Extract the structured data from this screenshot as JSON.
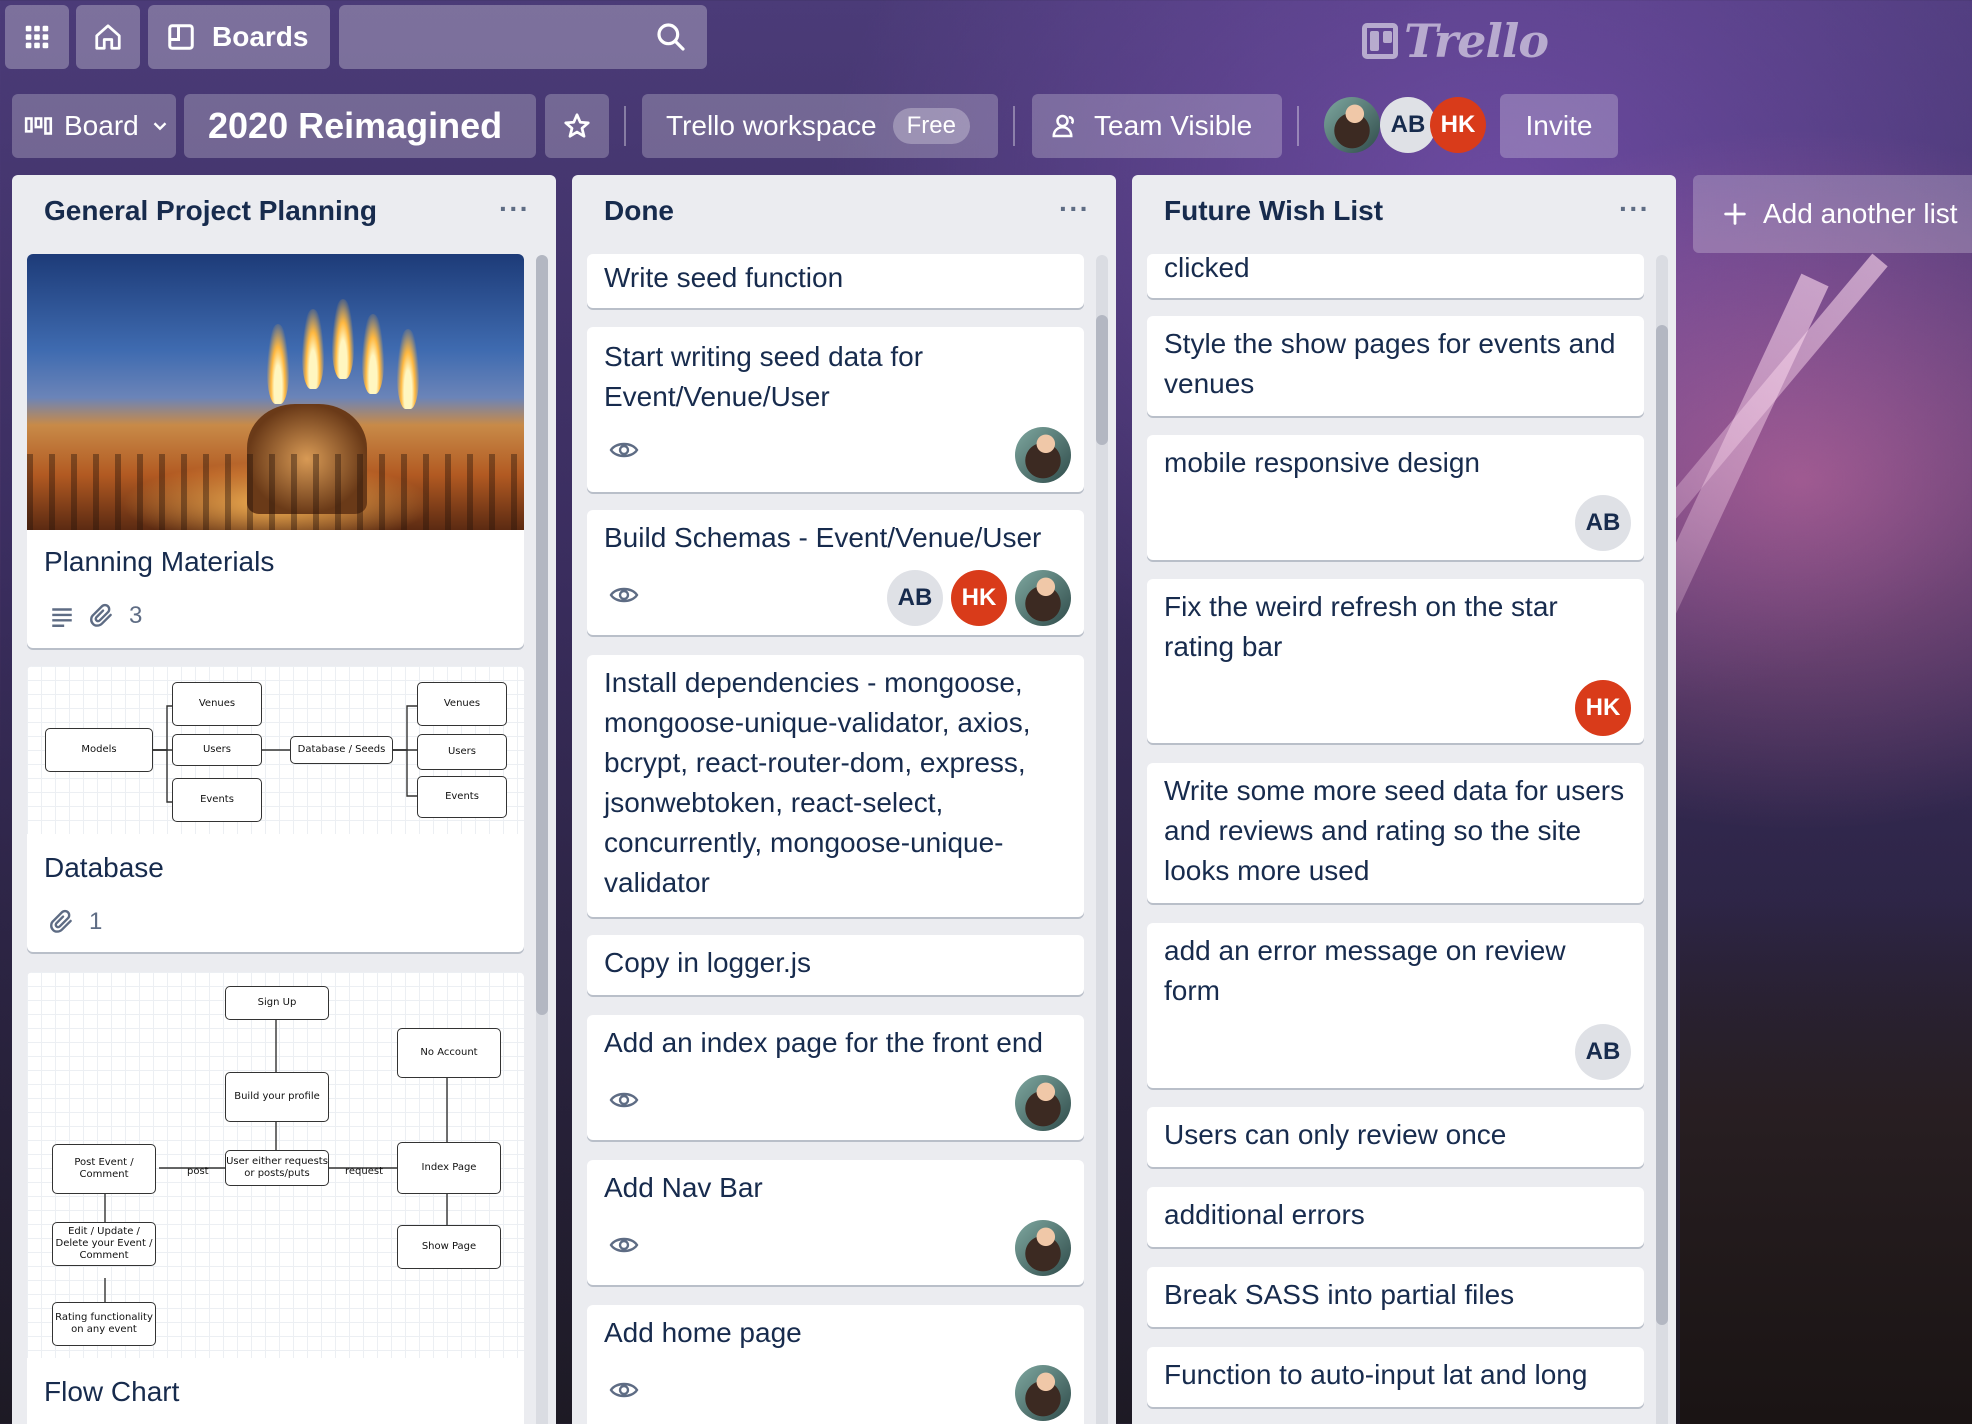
{
  "header": {
    "boards_label": "Boards",
    "search_placeholder": "",
    "logo_text": "Trello"
  },
  "board": {
    "view_label": "Board",
    "title": "2020 Reimagined",
    "workspace_label": "Trello workspace",
    "workspace_badge": "Free",
    "visibility_label": "Team Visible",
    "members": [
      "AB",
      "HK"
    ],
    "invite_label": "Invite"
  },
  "lists": [
    {
      "title": "General Project Planning",
      "cards": [
        {
          "title": "Planning Materials",
          "attachments": "3"
        },
        {
          "title": "Database",
          "attachments": "1"
        },
        {
          "title": "Flow Chart"
        }
      ]
    },
    {
      "title": "Done",
      "cards": [
        {
          "title": "Write seed function"
        },
        {
          "title": "Start writing seed data for Event/Venue/User"
        },
        {
          "title": "Build Schemas - Event/Venue/User",
          "members": [
            "AB",
            "HK"
          ]
        },
        {
          "title": "Install dependencies - mongoose, mongoose-unique-validator, axios, bcrypt, react-router-dom, express, jsonwebtoken, react-select, concurrently, mongoose-unique-validator"
        },
        {
          "title": "Copy in logger.js"
        },
        {
          "title": "Add an index page for the front end"
        },
        {
          "title": "Add Nav Bar"
        },
        {
          "title": "Add home page"
        }
      ]
    },
    {
      "title": "Future Wish List",
      "cards": [
        {
          "title": "clicked"
        },
        {
          "title": "Style the show pages for events and venues"
        },
        {
          "title": "mobile responsive design",
          "members": [
            "AB"
          ]
        },
        {
          "title": "Fix the weird refresh on the star rating bar",
          "members": [
            "HK"
          ]
        },
        {
          "title": "Write some more seed data for users and reviews and rating so the site looks more used"
        },
        {
          "title": "add an error message on review form",
          "members": [
            "AB"
          ]
        },
        {
          "title": "Users can only review once"
        },
        {
          "title": "additional errors"
        },
        {
          "title": "Break SASS into partial files"
        },
        {
          "title": "Function to auto-input lat and long"
        }
      ]
    }
  ],
  "add_list_label": "Add another list",
  "diagram_db": {
    "models": "Models",
    "venues": "Venues",
    "users": "Users",
    "events": "Events",
    "seeds": "Database / Seeds"
  },
  "diagram_flow": {
    "signup": "Sign Up",
    "no_account": "No Account",
    "build_profile": "Build your profile",
    "post_event": "Post Event / Comment",
    "user_requests": "User either requests or posts/puts",
    "index_page": "Index Page",
    "edit_event": "Edit / Update / Delete your Event / Comment",
    "show_page": "Show Page",
    "rating": "Rating functionality on any event",
    "post": "post",
    "request": "request"
  }
}
